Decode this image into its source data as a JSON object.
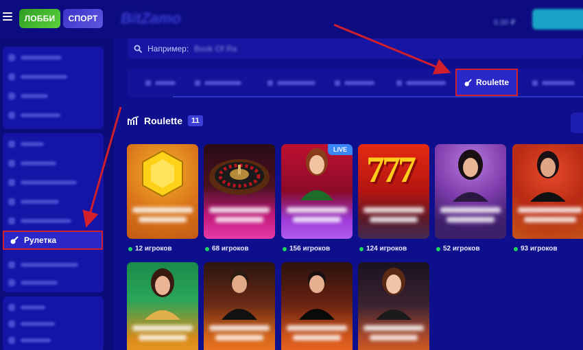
{
  "header": {
    "lobby_label": "ЛОББИ",
    "sport_label": "СПОРТ"
  },
  "search": {
    "placeholder_label": "Например:"
  },
  "tabs": {
    "active_label": "Roulette"
  },
  "sidebar": {
    "active_item_label": "Рулетка"
  },
  "section": {
    "title": "Roulette",
    "count": "11"
  },
  "games": [
    {
      "players": "12 игроков",
      "live": false
    },
    {
      "players": "68 игроков",
      "live": false
    },
    {
      "players": "156 игроков",
      "live": true,
      "live_label": "LIVE"
    },
    {
      "players": "124 игроков",
      "live": false
    },
    {
      "players": "52 игроков",
      "live": false
    },
    {
      "players": "93 игроков",
      "live": false
    },
    {
      "players": "",
      "live": false
    },
    {
      "players": "",
      "live": false
    },
    {
      "players": "",
      "live": false
    },
    {
      "players": "",
      "live": false
    }
  ],
  "colors": {
    "background": "#0e0f8c",
    "highlight": "#d21f2c",
    "online_dot": "#1ed760",
    "live_badge": "#3b86f5"
  }
}
